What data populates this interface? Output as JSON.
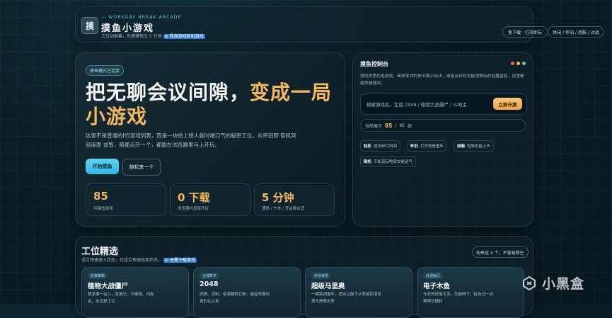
{
  "header": {
    "logo_char": "摸",
    "eyebrow": "— WORKDAY BREAK ARCADE",
    "title": "摸鱼小游戏",
    "subtitle": "工位功屏幕，先摸摸快乐 5 分钟",
    "subtitle_link": "⊞ 视频游戏新机游戏",
    "pill_download": "免下载 · 打开即玩",
    "pill_categories": "休闲 / 怀旧 / 烧脑 / 对战"
  },
  "hero": {
    "badge": "摸鱼模式已连接",
    "title_part1": "把无聊会议间隙，",
    "title_accent1": "变成一",
    "title_accent2": "局小游戏",
    "description": "这里不是普通的H5游戏列表，而是一块给上班人临时喘口气的秘密工位。从怀旧即 街机到轻度即 益智，随便点开一个，都能在浏览器里马上开玩。",
    "btn_start": "开始摸鱼",
    "btn_random": "随机来一个",
    "stats": [
      {
        "value": "85",
        "label": "可摸鱼游戏"
      },
      {
        "value": "0 下载",
        "label": "浏览器内直接开玩"
      },
      {
        "value": "5 分钟",
        "label": "通勤 / 午休 / 开会都合适"
      }
    ]
  },
  "console": {
    "title": "摸鱼控制台",
    "dot_colors": [
      "#f36b5b",
      "#f3b859",
      "#5fd38a"
    ],
    "description": "想找熟悉的老游戏、简单发泄的快节奏小玩法，或者会议时也能悄悄玩的轻量益智，这里都能快速搜到。",
    "search_placeholder": "搜索游戏名，比如 2048 / 植物大战僵尸 / 斗地主",
    "search_btn": "立即开摸",
    "count_prefix": "当前展示",
    "count_current": "85",
    "count_sep": "/",
    "count_total": "85",
    "count_unit": "款",
    "chips": [
      {
        "tag": "轻松",
        "text": "适合碎片时间"
      },
      {
        "tag": "怀旧",
        "text": "打开就是童年"
      },
      {
        "tag": "烧脑",
        "text": "短局也能上头"
      },
      {
        "tag": "随机",
        "text": "不知道玩啥就交给运气"
      }
    ]
  },
  "picks": {
    "title": "工位精选",
    "subtitle": "适合快速进入状态，也适合快速逃离状态。",
    "subtitle_link": "⊞ 无需下载游戏",
    "pill_random": "先来这 4 个，不容易踩空",
    "cards": [
      {
        "tag": "经典策略",
        "title": "植物大战僵尸",
        "desc": "想多摸一会儿，就选它。节奏稳、内容足，永远是工位"
      },
      {
        "tag": "合成数字",
        "title": "2048",
        "desc": "安静、克制、容易翻转打断，最起来像你真的在认真"
      },
      {
        "tag": "怀旧钟爱",
        "title": "超级马里奥",
        "desc": "一脚踩回童年，适合让脑子从表格和消息里先挣脱出来"
      },
      {
        "tag": "低调解压",
        "title": "电子木鱼",
        "desc": "今天的烦恼太多，先敲两下，给自己一点赛博功德和"
      }
    ]
  },
  "watermark": {
    "text": "小黑盒"
  }
}
